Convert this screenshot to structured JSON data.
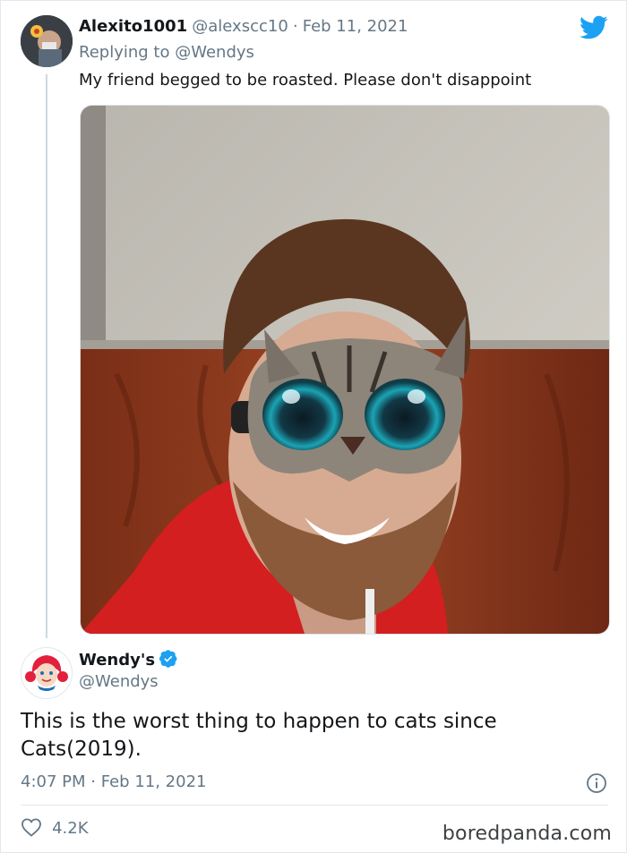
{
  "reply_tweet": {
    "display_name": "Alexito1001",
    "handle": "@alexscc10",
    "separator": "·",
    "date": "Feb 11, 2021",
    "replying_prefix": "Replying to",
    "replying_to": "@Wendys",
    "text": "My friend begged to be roasted. Please don't disappoint",
    "avatar_icon": "user-avatar"
  },
  "main_tweet": {
    "display_name": "Wendy's",
    "handle": "@Wendys",
    "verified_icon": "verified-badge-icon",
    "text": "This is the worst thing to happen to cats since Cats(2019).",
    "time": "4:07 PM",
    "separator": "·",
    "date": "Feb 11, 2021",
    "likes": "4.2K",
    "info_icon": "info-icon",
    "like_icon": "heart-icon"
  },
  "brand": {
    "platform_icon": "twitter-bird-icon",
    "watermark": "boredpanda.com"
  },
  "colors": {
    "accent": "#1da1f2",
    "text": "#14171a",
    "muted": "#657786",
    "wendys_red": "#e2203d"
  }
}
